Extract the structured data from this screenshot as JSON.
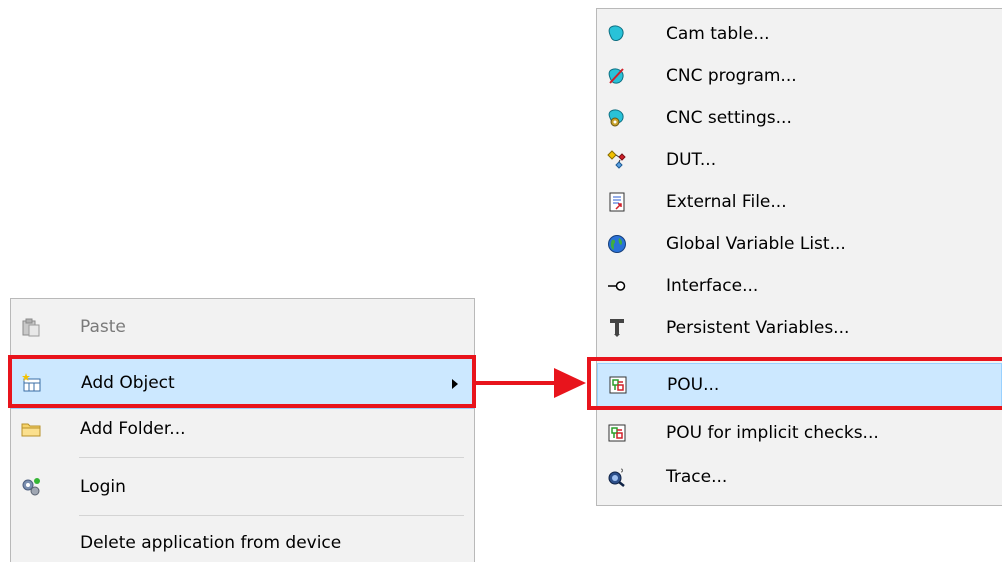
{
  "context_menu": {
    "items": [
      {
        "label": "Paste",
        "icon": "paste-icon",
        "disabled": true
      },
      {
        "label": "Add Object",
        "icon": "add-object-icon",
        "has_submenu": true,
        "highlighted": true
      },
      {
        "label": "Add Folder...",
        "icon": "folder-icon"
      },
      {
        "label": "Login",
        "icon": "login-gears-icon"
      },
      {
        "label": "Delete application from device",
        "icon": null
      }
    ]
  },
  "submenu": {
    "items": [
      {
        "label": "Cam table...",
        "icon": "cam-table-icon"
      },
      {
        "label": "CNC program...",
        "icon": "cnc-program-icon"
      },
      {
        "label": "CNC settings...",
        "icon": "cnc-settings-icon"
      },
      {
        "label": "DUT...",
        "icon": "dut-icon"
      },
      {
        "label": "External File...",
        "icon": "external-file-icon"
      },
      {
        "label": "Global Variable List...",
        "icon": "globe-icon"
      },
      {
        "label": "Interface...",
        "icon": "interface-icon"
      },
      {
        "label": "Persistent Variables...",
        "icon": "persistent-variables-icon"
      },
      {
        "label": "POU...",
        "icon": "pou-icon",
        "highlighted": true
      },
      {
        "label": "POU for implicit checks...",
        "icon": "pou-icon"
      },
      {
        "label": "Trace...",
        "icon": "trace-icon"
      }
    ]
  },
  "colors": {
    "highlight": "#cce8ff",
    "annotation_red": "#e8141c",
    "menu_bg": "#f2f2f2"
  }
}
